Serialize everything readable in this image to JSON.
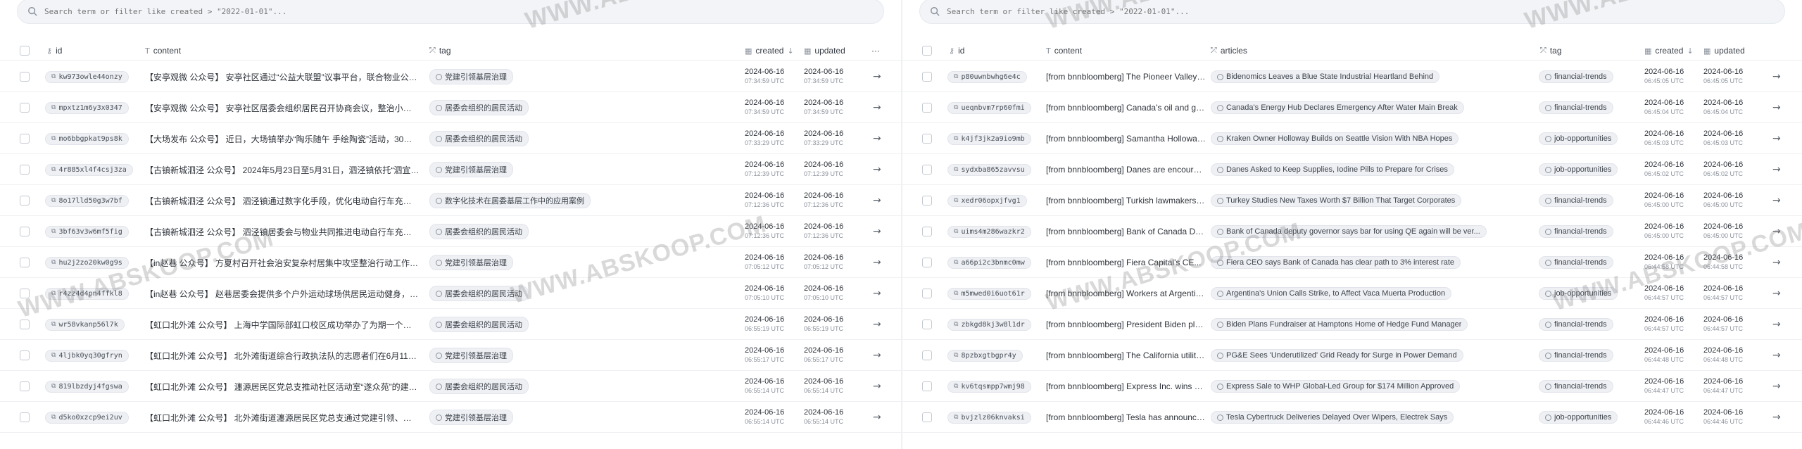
{
  "left": {
    "search": {
      "placeholder": "Search term or filter like created > \"2022-01-01\"..."
    },
    "columns": {
      "id": "id",
      "content": "content",
      "tag": "tag",
      "created": "created",
      "updated": "updated",
      "more": "···"
    },
    "rows": [
      {
        "id": "kw973owle44onzy",
        "content": "【安亭观微 公众号】 安亭社区通过“公益大联盟”议事平台，联合物业公司...",
        "tag": "党建引领基层治理",
        "created_date": "2024-06-16",
        "created_time": "07:34:59 UTC",
        "updated_date": "2024-06-16",
        "updated_time": "07:34:59 UTC"
      },
      {
        "id": "mpxtz1m6y3x0347",
        "content": "【安亭观微 公众号】 安亭社区居委会组织居民召开协商会议，整治小区外...",
        "tag": "居委会组织的居民活动",
        "created_date": "2024-06-16",
        "created_time": "07:34:59 UTC",
        "updated_date": "2024-06-16",
        "updated_time": "07:34:59 UTC"
      },
      {
        "id": "mo6bbgpkat9ps8k",
        "content": "【大场发布 公众号】 近日，大场镇举办“陶乐随午 手绘陶瓷”活动，30多位...",
        "tag": "居委会组织的居民活动",
        "created_date": "2024-06-16",
        "created_time": "07:33:29 UTC",
        "updated_date": "2024-06-16",
        "updated_time": "07:33:29 UTC"
      },
      {
        "id": "4r885xl4f4csj3za",
        "content": "【古镇新城泗泾 公众号】 2024年5月23日至5月31日，泗泾镇依托“泗宜坊”...",
        "tag": "党建引领基层治理",
        "created_date": "2024-06-16",
        "created_time": "07:12:39 UTC",
        "updated_date": "2024-06-16",
        "updated_time": "07:12:39 UTC"
      },
      {
        "id": "8o17lld50g3w7bf",
        "content": "【古镇新城泗泾 公众号】 泗泾镇通过数字化手段，优化电动自行车充电桩...",
        "tag": "数字化技术在居委基层工作中的应用案例",
        "created_date": "2024-06-16",
        "created_time": "07:12:36 UTC",
        "updated_date": "2024-06-16",
        "updated_time": "07:12:36 UTC"
      },
      {
        "id": "3bf63v3w6mf5fig",
        "content": "【古镇新城泗泾 公众号】 泗泾镇居委会与物业共同推进电动自行车充电桩...",
        "tag": "居委会组织的居民活动",
        "created_date": "2024-06-16",
        "created_time": "07:12:36 UTC",
        "updated_date": "2024-06-16",
        "updated_time": "07:12:36 UTC"
      },
      {
        "id": "hu2j2zo20kw0g9s",
        "content": "【in赵巷 公众号】 方夏村召开社会治安复杂村居集中攻坚整治行动工作部...",
        "tag": "党建引领基层治理",
        "created_date": "2024-06-16",
        "created_time": "07:05:12 UTC",
        "updated_date": "2024-06-16",
        "updated_time": "07:05:12 UTC"
      },
      {
        "id": "r4zz4d4pn4ffkl8",
        "content": "【in赵巷 公众号】 赵巷居委会提供多个户外运动球场供居民运动健身，包...",
        "tag": "居委会组织的居民活动",
        "created_date": "2024-06-16",
        "created_time": "07:05:10 UTC",
        "updated_date": "2024-06-16",
        "updated_time": "07:05:10 UTC"
      },
      {
        "id": "wr58vkanp56l7k",
        "content": "【虹口北外滩 公众号】 上海中学国际部虹口校区成功举办了为期一个月的...",
        "tag": "居委会组织的居民活动",
        "created_date": "2024-06-16",
        "created_time": "06:55:19 UTC",
        "updated_date": "2024-06-16",
        "updated_time": "06:55:19 UTC"
      },
      {
        "id": "4ljbk0yq30gfryn",
        "content": "【虹口北外滩 公众号】 北外滩街道综合行政执法队的志愿者们在6月11日至...",
        "tag": "党建引领基层治理",
        "created_date": "2024-06-16",
        "created_time": "06:55:17 UTC",
        "updated_date": "2024-06-16",
        "updated_time": "06:55:17 UTC"
      },
      {
        "id": "819lbzdyj4fgswa",
        "content": "【虹口北外滩 公众号】 瀍源居民区党总支推动社区活动室“遂众苑”的建设...",
        "tag": "居委会组织的居民活动",
        "created_date": "2024-06-16",
        "created_time": "06:55:14 UTC",
        "updated_date": "2024-06-16",
        "updated_time": "06:55:14 UTC"
      },
      {
        "id": "d5ko0xzcp9ei2uv",
        "content": "【虹口北外滩 公众号】 北外滩街道瀍源居民区党总支通过党建引领、解决...",
        "tag": "党建引领基层治理",
        "created_date": "2024-06-16",
        "created_time": "06:55:14 UTC",
        "updated_date": "2024-06-16",
        "updated_time": "06:55:14 UTC"
      }
    ]
  },
  "right": {
    "search": {
      "placeholder": "Search term or filter like created > \"2022-01-01\"..."
    },
    "columns": {
      "id": "id",
      "content": "content",
      "articles": "articles",
      "tag": "tag",
      "created": "created",
      "updated": "updated"
    },
    "rows": [
      {
        "id": "p80uwnbwhg6e4c",
        "content": "[from bnnbloomberg] The Pioneer Valley of ...",
        "article": "Bidenomics Leaves a Blue State Industrial Heartland Behind",
        "tag": "financial-trends",
        "created_date": "2024-06-16",
        "created_time": "06:45:05 UTC",
        "updated_date": "2024-06-16",
        "updated_time": "06:45:05 UTC"
      },
      {
        "id": "ueqnbvm7rp60fmi",
        "content": "[from bnnbloomberg] Canada's oil and gas i...",
        "article": "Canada's Energy Hub Declares Emergency After Water Main Break",
        "tag": "financial-trends",
        "created_date": "2024-06-16",
        "created_time": "06:45:04 UTC",
        "updated_date": "2024-06-16",
        "updated_time": "06:45:04 UTC"
      },
      {
        "id": "k4jf3jk2a9io9mb",
        "content": "[from bnnbloomberg] Samantha Holloway t...",
        "article": "Kraken Owner Holloway Builds on Seattle Vision With NBA Hopes",
        "tag": "job-opportunities",
        "created_date": "2024-06-16",
        "created_time": "06:45:03 UTC",
        "updated_date": "2024-06-16",
        "updated_time": "06:45:03 UTC"
      },
      {
        "id": "sydxba865zavvsu",
        "content": "[from bnnbloomberg] Danes are encourage...",
        "article": "Danes Asked to Keep Supplies, Iodine Pills to Prepare for Crises",
        "tag": "job-opportunities",
        "created_date": "2024-06-16",
        "created_time": "06:45:02 UTC",
        "updated_date": "2024-06-16",
        "updated_time": "06:45:02 UTC"
      },
      {
        "id": "xedr06opxjfvg1",
        "content": "[from bnnbloomberg] Turkish lawmakers dr...",
        "article": "Turkey Studies New Taxes Worth $7 Billion That Target Corporates",
        "tag": "financial-trends",
        "created_date": "2024-06-16",
        "created_time": "06:45:00 UTC",
        "updated_date": "2024-06-16",
        "updated_time": "06:45:00 UTC"
      },
      {
        "id": "uims4m286wazkr2",
        "content": "[from bnnbloomberg] Bank of Canada Depu...",
        "article": "Bank of Canada deputy governor says bar for using QE again will be ver...",
        "tag": "financial-trends",
        "created_date": "2024-06-16",
        "created_time": "06:45:00 UTC",
        "updated_date": "2024-06-16",
        "updated_time": "06:45:00 UTC"
      },
      {
        "id": "a66pi2c3bnmc0mw",
        "content": "[from bnnbloomberg] Fiera Capital's CE...",
        "article": "Fiera CEO says Bank of Canada has clear path to 3% interest rate",
        "tag": "financial-trends",
        "created_date": "2024-06-16",
        "created_time": "06:44:58 UTC",
        "updated_date": "2024-06-16",
        "updated_time": "06:44:58 UTC"
      },
      {
        "id": "m5mwed0i6uot61r",
        "content": "[from bnnbloomberg] Workers at Argentina'...",
        "article": "Argentina's Union Calls Strike, to Affect Vaca Muerta Production",
        "tag": "job-opportunities",
        "created_date": "2024-06-16",
        "created_time": "06:44:57 UTC",
        "updated_date": "2024-06-16",
        "updated_time": "06:44:57 UTC"
      },
      {
        "id": "zbkgd8kj3w8l1dr",
        "content": "[from bnnbloomberg] President Biden plan...",
        "article": "Biden Plans Fundraiser at Hamptons Home of Hedge Fund Manager",
        "tag": "financial-trends",
        "created_date": "2024-06-16",
        "created_time": "06:44:57 UTC",
        "updated_date": "2024-06-16",
        "updated_time": "06:44:57 UTC"
      },
      {
        "id": "8pzbxgtbgpr4y",
        "content": "[from bnnbloomberg] The California utility ...",
        "article": "PG&E Sees 'Underutilized' Grid Ready for Surge in Power Demand",
        "tag": "financial-trends",
        "created_date": "2024-06-16",
        "created_time": "06:44:48 UTC",
        "updated_date": "2024-06-16",
        "updated_time": "06:44:48 UTC"
      },
      {
        "id": "kv6tqsmpp7wmj98",
        "content": "[from bnnbloomberg] Express Inc. wins ban...",
        "article": "Express Sale to WHP Global-Led Group for $174 Million Approved",
        "tag": "financial-trends",
        "created_date": "2024-06-16",
        "created_time": "06:44:47 UTC",
        "updated_date": "2024-06-16",
        "updated_time": "06:44:47 UTC"
      },
      {
        "id": "bvjzlz06knvaksi",
        "content": "[from bnnbloomberg] Tesla has announced ...",
        "article": "Tesla Cybertruck Deliveries Delayed Over Wipers, Electrek Says",
        "tag": "job-opportunities",
        "created_date": "2024-06-16",
        "created_time": "06:44:46 UTC",
        "updated_date": "2024-06-16",
        "updated_time": "06:44:46 UTC"
      }
    ]
  },
  "watermark": "WWW.ABSKOOP.COM"
}
